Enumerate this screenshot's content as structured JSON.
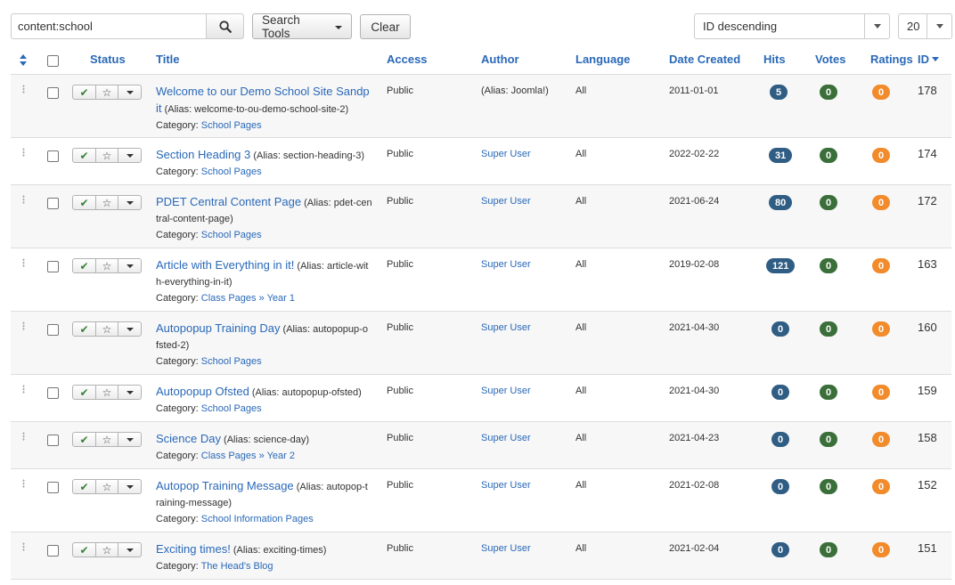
{
  "toolbar": {
    "search_value": "content:school",
    "search_tools_label": "Search Tools",
    "clear_label": "Clear",
    "order_value": "ID descending",
    "limit_value": "20"
  },
  "columns": {
    "status": "Status",
    "title": "Title",
    "access": "Access",
    "author": "Author",
    "language": "Language",
    "date_created": "Date Created",
    "hits": "Hits",
    "votes": "Votes",
    "ratings": "Ratings",
    "id": "ID"
  },
  "colors": {
    "link": "#2a69b8",
    "hits_badge": "#2f5d83",
    "votes_badge": "#3b6f3a",
    "ratings_badge": "#f28b2b",
    "published_check": "#378137"
  },
  "rows": [
    {
      "title": "Welcome to our Demo School Site Sandp",
      "title_wrap": "it",
      "alias": "(Alias: welcome-to-ou-demo-school-site-2)",
      "alias_inline": "",
      "category_label": "Category:",
      "category": "School Pages",
      "category_sub": "",
      "access": "Public",
      "author": "",
      "author_alias": "(Alias: Joomla!)",
      "language": "All",
      "date": "2011-01-01",
      "hits": "5",
      "votes": "0",
      "ratings": "0",
      "id": "178"
    },
    {
      "title": "Section Heading 3",
      "title_wrap": "",
      "alias": "",
      "alias_inline": "(Alias: section-heading-3)",
      "category_label": "Category:",
      "category": "School Pages",
      "category_sub": "",
      "access": "Public",
      "author": "Super User",
      "author_alias": "",
      "language": "All",
      "date": "2022-02-22",
      "hits": "31",
      "votes": "0",
      "ratings": "0",
      "id": "174"
    },
    {
      "title": "PDET Central Content Page",
      "title_wrap": "",
      "alias": "tral-content-page)",
      "alias_inline": "(Alias: pdet-cen",
      "category_label": "Category:",
      "category": "School Pages",
      "category_sub": "",
      "access": "Public",
      "author": "Super User",
      "author_alias": "",
      "language": "All",
      "date": "2021-06-24",
      "hits": "80",
      "votes": "0",
      "ratings": "0",
      "id": "172"
    },
    {
      "title": "Article with Everything in it!",
      "title_wrap": "",
      "alias": "h-everything-in-it)",
      "alias_inline": "(Alias: article-wit",
      "category_label": "Category:",
      "category": "Class Pages",
      "category_sub": "» Year 1",
      "access": "Public",
      "author": "Super User",
      "author_alias": "",
      "language": "All",
      "date": "2019-02-08",
      "hits": "121",
      "votes": "0",
      "ratings": "0",
      "id": "163"
    },
    {
      "title": "Autopopup Training Day",
      "title_wrap": "",
      "alias": "fsted-2)",
      "alias_inline": "(Alias: autopopup-o",
      "category_label": "Category:",
      "category": "School Pages",
      "category_sub": "",
      "access": "Public",
      "author": "Super User",
      "author_alias": "",
      "language": "All",
      "date": "2021-04-30",
      "hits": "0",
      "votes": "0",
      "ratings": "0",
      "id": "160"
    },
    {
      "title": "Autopopup Ofsted",
      "title_wrap": "",
      "alias": "",
      "alias_inline": "(Alias: autopopup-ofsted)",
      "category_label": "Category:",
      "category": "School Pages",
      "category_sub": "",
      "access": "Public",
      "author": "Super User",
      "author_alias": "",
      "language": "All",
      "date": "2021-04-30",
      "hits": "0",
      "votes": "0",
      "ratings": "0",
      "id": "159"
    },
    {
      "title": "Science Day",
      "title_wrap": "",
      "alias": "",
      "alias_inline": "(Alias: science-day)",
      "category_label": "Category:",
      "category": "Class Pages",
      "category_sub": "» Year 2",
      "access": "Public",
      "author": "Super User",
      "author_alias": "",
      "language": "All",
      "date": "2021-04-23",
      "hits": "0",
      "votes": "0",
      "ratings": "0",
      "id": "158"
    },
    {
      "title": "Autopop Training Message",
      "title_wrap": "",
      "alias": "raining-message)",
      "alias_inline": "(Alias: autopop-t",
      "category_label": "Category:",
      "category": "School Information Pages",
      "category_sub": "",
      "access": "Public",
      "author": "Super User",
      "author_alias": "",
      "language": "All",
      "date": "2021-02-08",
      "hits": "0",
      "votes": "0",
      "ratings": "0",
      "id": "152"
    },
    {
      "title": "Exciting times!",
      "title_wrap": "",
      "alias": "",
      "alias_inline": "(Alias: exciting-times)",
      "category_label": "Category:",
      "category": "The Head's Blog",
      "category_sub": "",
      "access": "Public",
      "author": "Super User",
      "author_alias": "",
      "language": "All",
      "date": "2021-02-04",
      "hits": "0",
      "votes": "0",
      "ratings": "0",
      "id": "151"
    }
  ]
}
